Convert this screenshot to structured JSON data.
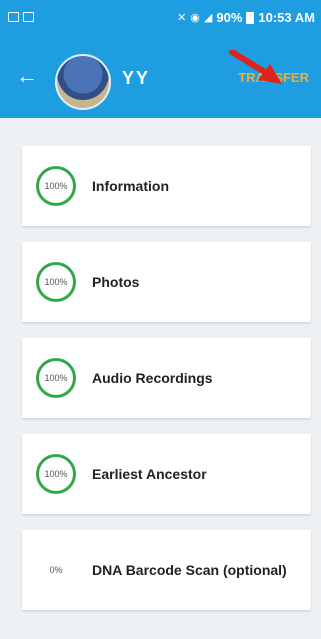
{
  "status_bar": {
    "time": "10:53 AM",
    "battery_percent": "90%",
    "icons": [
      "notification-icon",
      "gallery-icon",
      "mute-icon",
      "wifi-icon",
      "signal-icon",
      "battery-icon"
    ]
  },
  "toolbar": {
    "title": "YY",
    "action_label": "TRANSFER"
  },
  "items": [
    {
      "percent": "100%",
      "label": "Information",
      "complete": true
    },
    {
      "percent": "100%",
      "label": "Photos",
      "complete": true
    },
    {
      "percent": "100%",
      "label": "Audio Recordings",
      "complete": true
    },
    {
      "percent": "100%",
      "label": "Earliest Ancestor",
      "complete": true
    },
    {
      "percent": "0%",
      "label": "DNA Barcode Scan (optional)",
      "complete": false
    }
  ],
  "colors": {
    "app_bar": "#1e9ee0",
    "action": "#f7ac2c",
    "progress": "#2fa84a",
    "annotation_arrow": "#e0221b"
  }
}
